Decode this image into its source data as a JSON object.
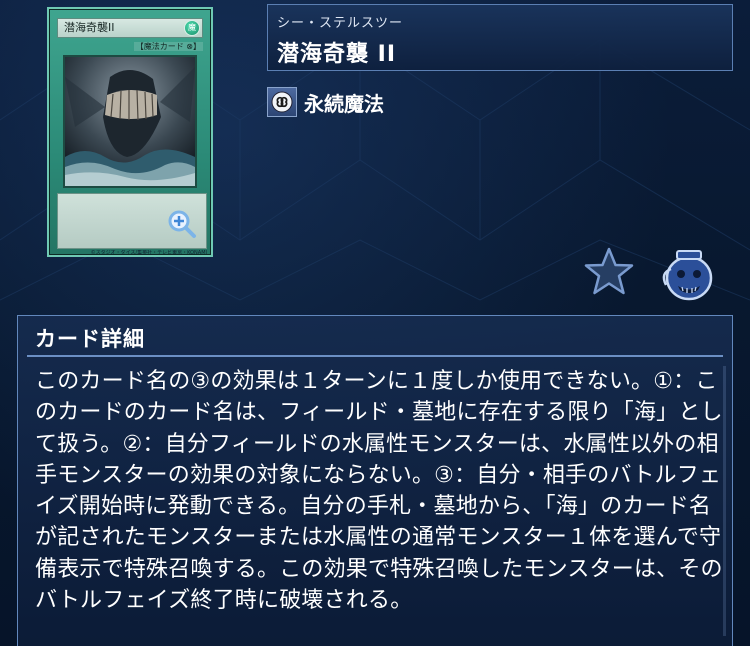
{
  "card": {
    "art_name": "潜海奇襲II",
    "attribute_glyph": "魔",
    "art_type": "【魔法カード ⊗】",
    "copyright": "©スタジオ・ダイス/集英社・テレビ東京・KONAMI"
  },
  "header": {
    "ruby": "シー・ステルスツー",
    "name": "潜海奇襲 II"
  },
  "type": {
    "icon": "continuous-spell-icon",
    "label": "永続魔法"
  },
  "actions": {
    "favorite_icon": "star-icon",
    "bag_icon": "pot-icon"
  },
  "detail": {
    "title": "カード詳細",
    "text": "このカード名の③の効果は１ターンに１度しか使用できない。①：このカードのカード名は、フィールド・墓地に存在する限り「海」として扱う。②：自分フィールドの水属性モンスターは、水属性以外の相手モンスターの効果の対象にならない。③：自分・相手のバトルフェイズ開始時に発動できる。自分の手札・墓地から、「海」のカード名が記されたモンスターまたは水属性の通常モンスター１体を選んで守備表示で特殊召喚する。この効果で特殊召喚したモンスターは、そのバトルフェイズ終了時に破壊される。"
  },
  "colors": {
    "background": "#0b1d3a",
    "panel_border": "#5b7fb3",
    "card_frame": "#2b8a77"
  }
}
